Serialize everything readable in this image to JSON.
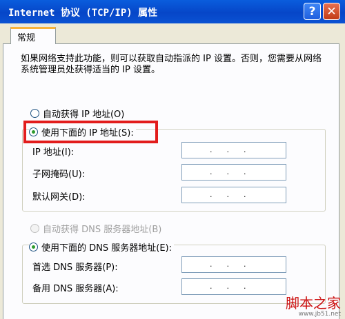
{
  "window": {
    "title": "Internet 协议 (TCP/IP) 属性",
    "help_label": "?",
    "close_label": "✕"
  },
  "tabs": [
    {
      "label": "常规"
    }
  ],
  "description": "如果网络支持此功能，则可以获取自动指派的 IP 设置。否则，您需要从网络系统管理员处获得适当的 IP 设置。",
  "ip_section": {
    "auto_label": "自动获得 IP 地址(O)",
    "manual_label": "使用下面的 IP 地址(S):",
    "selected": "manual",
    "fields": [
      {
        "label": "IP 地址(I):",
        "dots": ".      .      ."
      },
      {
        "label": "子网掩码(U):",
        "dots": ".      .      ."
      },
      {
        "label": "默认网关(D):",
        "dots": ".      .      ."
      }
    ]
  },
  "dns_section": {
    "auto_label": "自动获得 DNS 服务器地址(B)",
    "auto_disabled": true,
    "manual_label": "使用下面的 DNS 服务器地址(E):",
    "selected": "manual",
    "fields": [
      {
        "label": "首选 DNS 服务器(P):",
        "dots": ".      .      ."
      },
      {
        "label": "备用 DNS 服务器(A):",
        "dots": ".      .      ."
      }
    ]
  },
  "watermark": {
    "text": "脚本之家",
    "url": "www.jb51.net"
  },
  "colors": {
    "titlebar": "#0646c8",
    "highlight": "#e21c1c",
    "radio_selected": "#2d9a2d"
  }
}
